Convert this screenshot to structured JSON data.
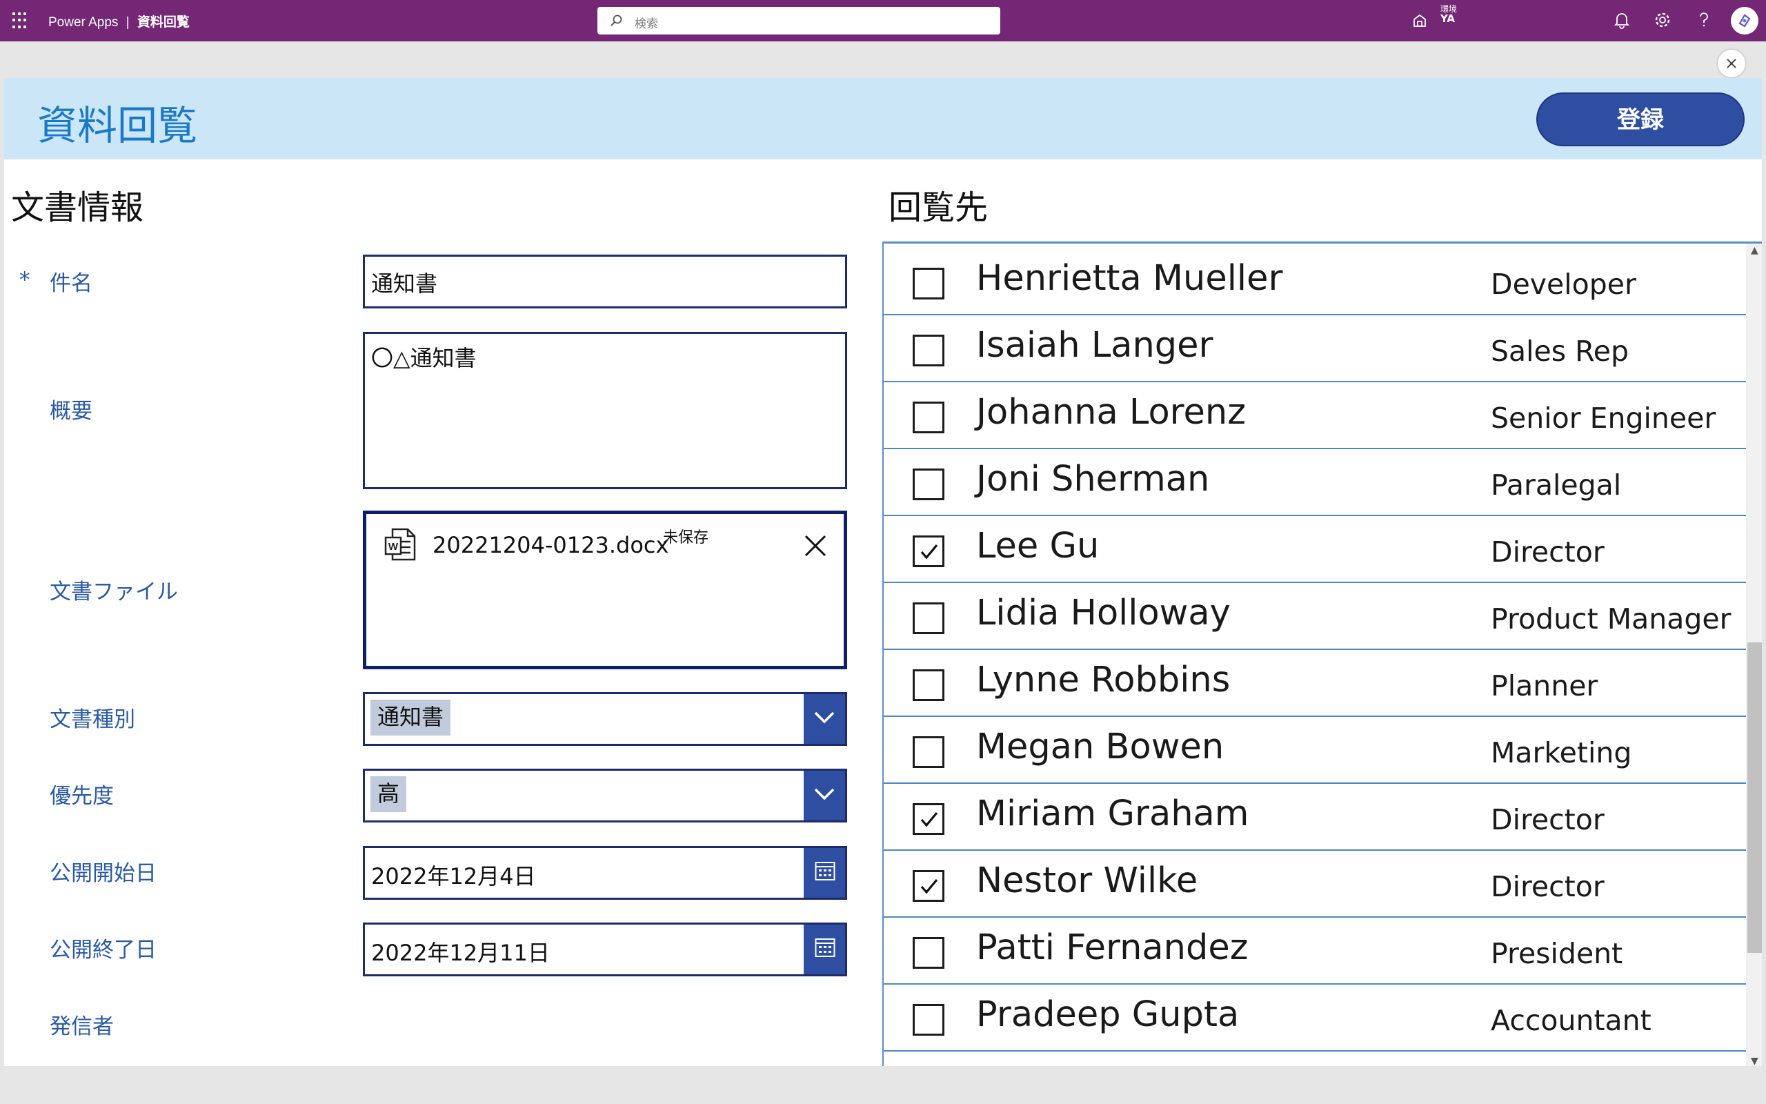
{
  "topbar": {
    "brand": "Power Apps",
    "separator": "|",
    "app_name": "資料回覧",
    "search_placeholder": "検索",
    "env_label": "環境",
    "env_value": "YA"
  },
  "header": {
    "title": "資料回覧",
    "register_label": "登録"
  },
  "left": {
    "section_title": "文書情報",
    "required_mark": "*",
    "labels": {
      "subject": "件名",
      "summary": "概要",
      "file": "文書ファイル",
      "doc_type": "文書種別",
      "priority": "優先度",
      "start_date": "公開開始日",
      "end_date": "公開終了日",
      "sender": "発信者"
    },
    "values": {
      "subject": "通知書",
      "summary": "〇△通知書",
      "file_name": "20221204-0123.docx",
      "file_status": "未保存",
      "doc_type": "通知書",
      "priority": "高",
      "start_date": "2022年12月4日",
      "end_date": "2022年12月11日"
    }
  },
  "right": {
    "section_title": "回覧先",
    "people": [
      {
        "name": "Henrietta Mueller",
        "role": "Developer",
        "checked": false
      },
      {
        "name": "Isaiah Langer",
        "role": "Sales Rep",
        "checked": false
      },
      {
        "name": "Johanna Lorenz",
        "role": "Senior Engineer",
        "checked": false
      },
      {
        "name": "Joni Sherman",
        "role": "Paralegal",
        "checked": false
      },
      {
        "name": "Lee Gu",
        "role": "Director",
        "checked": true
      },
      {
        "name": "Lidia Holloway",
        "role": "Product Manager",
        "checked": false
      },
      {
        "name": "Lynne Robbins",
        "role": "Planner",
        "checked": false
      },
      {
        "name": "Megan Bowen",
        "role": "Marketing",
        "checked": false
      },
      {
        "name": "Miriam Graham",
        "role": "Director",
        "checked": true
      },
      {
        "name": "Nestor Wilke",
        "role": "Director",
        "checked": true
      },
      {
        "name": "Patti Fernandez",
        "role": "President",
        "checked": false
      },
      {
        "name": "Pradeep Gupta",
        "role": "Accountant",
        "checked": false
      }
    ]
  },
  "colors": {
    "topbar": "#742774",
    "header_bg": "#cbe6f6",
    "title_blue": "#1a7ac8",
    "button_blue": "#2d4ea1",
    "label_blue": "#2b5aa3"
  }
}
